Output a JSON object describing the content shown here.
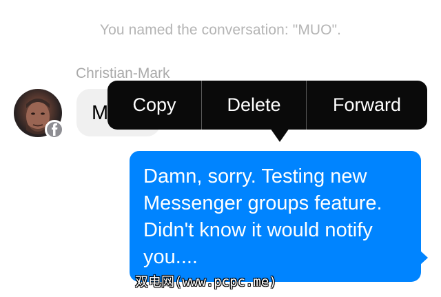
{
  "conversation": {
    "system_notice": "You named the conversation: \"MUO\"."
  },
  "incoming_message": {
    "sender_name": "Christian-Mark",
    "text_visible": "M",
    "avatar_badge_icon": "facebook-icon"
  },
  "context_menu": {
    "items": [
      {
        "label": "Copy"
      },
      {
        "label": "Delete"
      },
      {
        "label": "Forward"
      }
    ]
  },
  "outgoing_message": {
    "text": "Damn, sorry. Testing new Messenger groups feature. Didn't know it would notify you...."
  },
  "watermark": {
    "text": "双电网(www.pcpc.me)"
  },
  "colors": {
    "outgoing_bubble": "#0084ff",
    "incoming_bubble": "#f0f0f0",
    "context_menu_bg": "#0a0a0a",
    "system_text": "#b4b4b4",
    "badge": "#8e8e93"
  }
}
